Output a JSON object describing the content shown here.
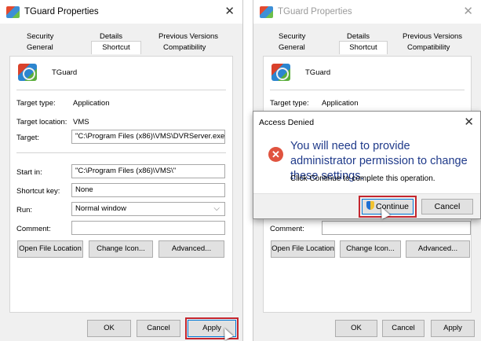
{
  "left_dialog": {
    "title": "TGuard Properties",
    "close_glyph": "✕",
    "tabs_row1": [
      "Security",
      "Details",
      "Previous Versions"
    ],
    "tabs_row2": [
      "General",
      "Shortcut",
      "Compatibility"
    ],
    "app_name": "TGuard",
    "target_type_label": "Target type:",
    "target_type_value": "Application",
    "target_location_label": "Target location:",
    "target_location_value": "VMS",
    "target_label": "Target:",
    "target_value": "\"C:\\Program Files (x86)\\VMS\\DVRServer.exe\"",
    "start_in_label": "Start in:",
    "start_in_value": "\"C:\\Program Files (x86)\\VMS\\\"",
    "shortcut_key_label": "Shortcut key:",
    "shortcut_key_value": "None",
    "run_label": "Run:",
    "run_value": "Normal window",
    "comment_label": "Comment:",
    "comment_value": "",
    "open_file_location": "Open File Location",
    "change_icon": "Change Icon...",
    "advanced": "Advanced...",
    "ok": "OK",
    "cancel": "Cancel",
    "apply": "Apply"
  },
  "right_dialog": {
    "title": "TGuard Properties",
    "close_glyph": "✕",
    "tabs_row1": [
      "Security",
      "Details",
      "Previous Versions"
    ],
    "tabs_row2": [
      "General",
      "Shortcut",
      "Compatibility"
    ],
    "app_name": "TGuard",
    "target_type_label": "Target type:",
    "target_type_value": "Application",
    "comment_label": "Comment:",
    "open_file_location": "Open File Location",
    "change_icon": "Change Icon...",
    "advanced": "Advanced...",
    "ok": "OK",
    "cancel": "Cancel",
    "apply": "Apply"
  },
  "access_denied": {
    "title": "Access Denied",
    "close_glyph": "✕",
    "error_glyph": "✕",
    "message": "You will need to provide administrator permission to change these settings.",
    "sub_message": "Click Continue to complete this operation.",
    "continue_label": "Continue",
    "cancel_label": "Cancel"
  },
  "colors": {
    "highlight": "#c4262e",
    "message_text": "#1f3a8a",
    "error": "#e0533f"
  }
}
